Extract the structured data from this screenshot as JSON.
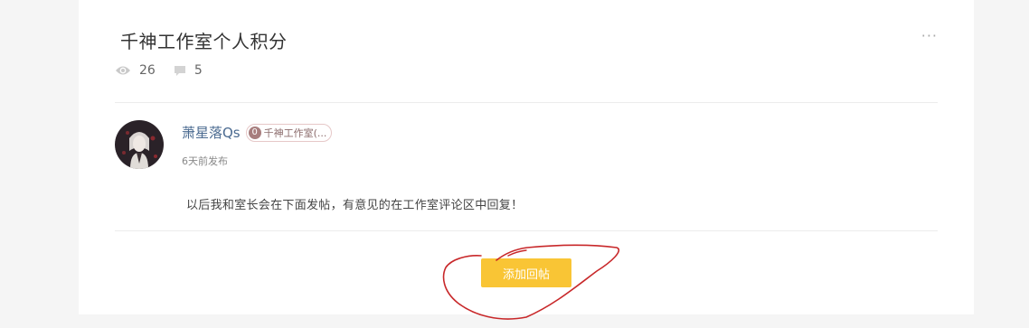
{
  "post": {
    "title": "千神工作室个人积分",
    "more_label": "···",
    "stats": {
      "views": "26",
      "comments": "5"
    }
  },
  "author": {
    "name": "萧星落Qs",
    "badge_level": "0",
    "badge_label": "千神工作室(...",
    "post_time": "6天前发布"
  },
  "content": {
    "text": "以后我和室长会在下面发帖，有意见的在工作室评论区中回复！"
  },
  "actions": {
    "reply_label": "添加回帖"
  },
  "colors": {
    "accent_button": "#f9c535",
    "author_link": "#4a6a90",
    "annotation_ink": "#c8282a"
  }
}
